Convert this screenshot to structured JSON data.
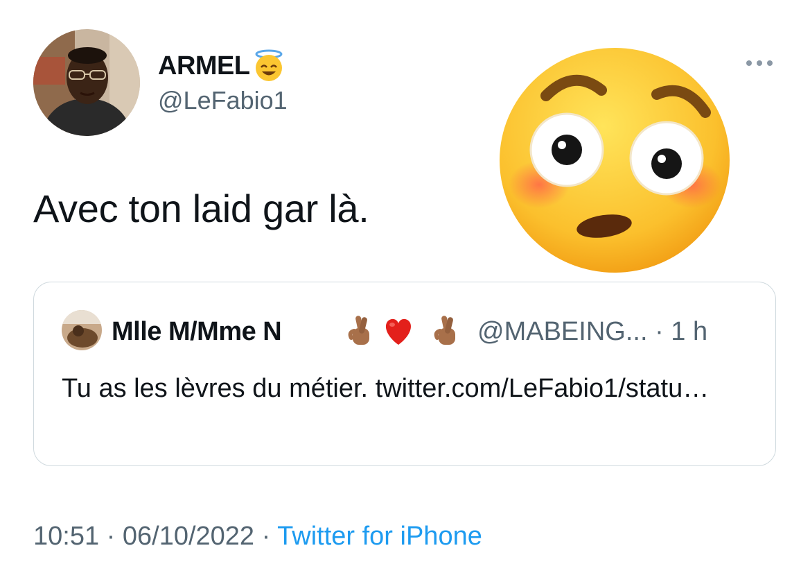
{
  "author": {
    "name": "ARMEL",
    "handle": "@LeFabio1",
    "name_emoji": "smiling-face-with-halo"
  },
  "tweet": {
    "text": "Avec ton laid gar là.",
    "reaction_emoji": "flushed-face"
  },
  "quote": {
    "name": "Mlle M/Mme N",
    "name_emojis": [
      "crossed-fingers-medium-dark",
      "red-heart",
      "crossed-fingers-medium-dark"
    ],
    "handle": "@MABEING...",
    "time": "1 h",
    "text": "Tu as les lèvres du métier. twitter.com/LeFabio1/statu…"
  },
  "meta": {
    "time": "10:51",
    "date": "06/10/2022",
    "source": "Twitter for iPhone"
  },
  "colors": {
    "text": "#0f1419",
    "secondary": "#536471",
    "link": "#1d9bf0",
    "border": "#cfd9de"
  }
}
